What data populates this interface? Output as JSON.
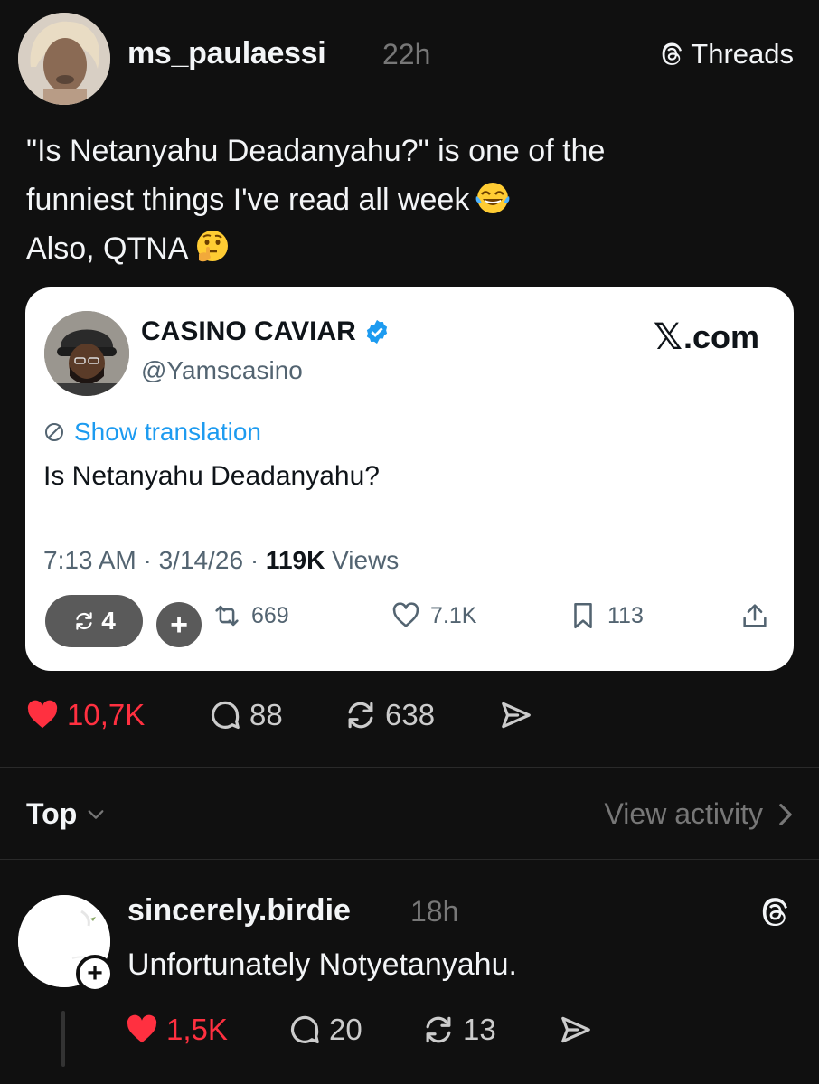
{
  "post": {
    "username": "ms_paulaessi",
    "time": "22h",
    "platform_label": "Threads",
    "text_lines": [
      "\"Is Netanyahu Deadanyahu?\" is one of the",
      "funniest things I've read all week",
      "Also, QTNA"
    ],
    "emojis": [
      "tears-of-joy-emoji",
      "thinking-face-emoji"
    ],
    "likes": "10,7K",
    "comments": "88",
    "reposts": "638",
    "liked": true
  },
  "embed": {
    "name": "CASINO CAVIAR",
    "handle": "@Yamscasino",
    "source": ".com",
    "show_translation": "Show translation",
    "text": "Is Netanyahu Deadanyahu?",
    "time": "7:13 AM · 3/14/26 · ",
    "views_count": "119K",
    "views_label": " Views",
    "quote_count": "4",
    "plus_label": "+",
    "retweets": "669",
    "likes": "7.1K",
    "bookmarks": "113"
  },
  "filter": {
    "sort_label": "Top",
    "view_activity": "View activity"
  },
  "reply": {
    "username": "sincerely.birdie",
    "time": "18h",
    "text": "Unfortunately Notyetanyahu.",
    "follow_label": "+",
    "likes": "1,5K",
    "comments": "20",
    "reposts": "13",
    "liked": true
  },
  "colors": {
    "background": "#101010",
    "like_red": "#ff3040",
    "x_link_blue": "#1d9bf0",
    "verified_blue": "#1d9bf0",
    "muted_gray": "#777777"
  }
}
